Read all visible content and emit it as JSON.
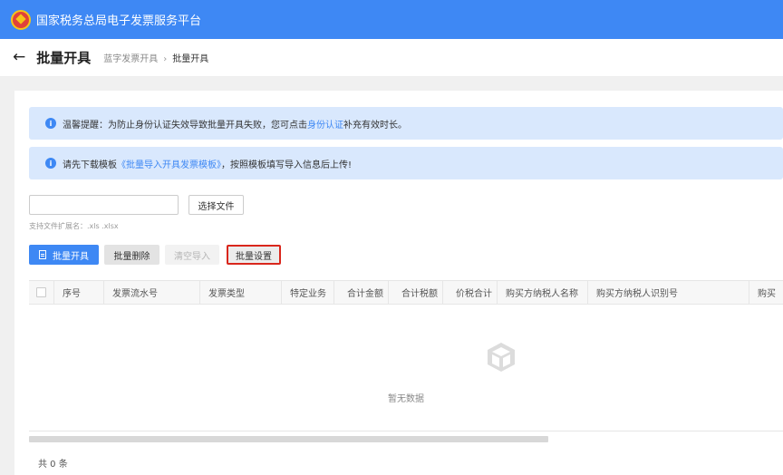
{
  "header": {
    "title": "国家税务总局电子发票服务平台",
    "emblem_icon": "national-emblem-icon",
    "color": "#3e88f4"
  },
  "page": {
    "title": "批量开具",
    "breadcrumb": [
      "蓝字发票开具",
      "批量开具"
    ]
  },
  "alerts": {
    "reminder": {
      "prefix": "温馨提醒：为防止身份认证失效导致批量开具失败，您可点击",
      "link": "身份认证",
      "suffix": "补充有效时长。"
    },
    "template": {
      "prefix": "请先下载模板",
      "link": "《批量导入开具发票模板》",
      "suffix": "，按照模板填写导入信息后上传!"
    }
  },
  "upload": {
    "file_value": "",
    "choose_file_label": "选择文件",
    "hint": "支持文件扩展名：.xls .xlsx"
  },
  "toolbar": {
    "issue_label": "批量开具",
    "delete_label": "批量删除",
    "clear_label": "清空导入",
    "settings_label": "批量设置"
  },
  "table": {
    "columns": [
      "序号",
      "发票流水号",
      "发票类型",
      "特定业务",
      "合计金额",
      "合计税额",
      "价税合计",
      "购买方纳税人名称",
      "购买方纳税人识别号",
      "购买"
    ],
    "empty_text": "暂无数据"
  },
  "footer": {
    "total": "共 0 条"
  },
  "colors": {
    "accent": "#3e88f4",
    "highlight_border": "#d9261c",
    "alert_bg": "#d9e8fd"
  }
}
